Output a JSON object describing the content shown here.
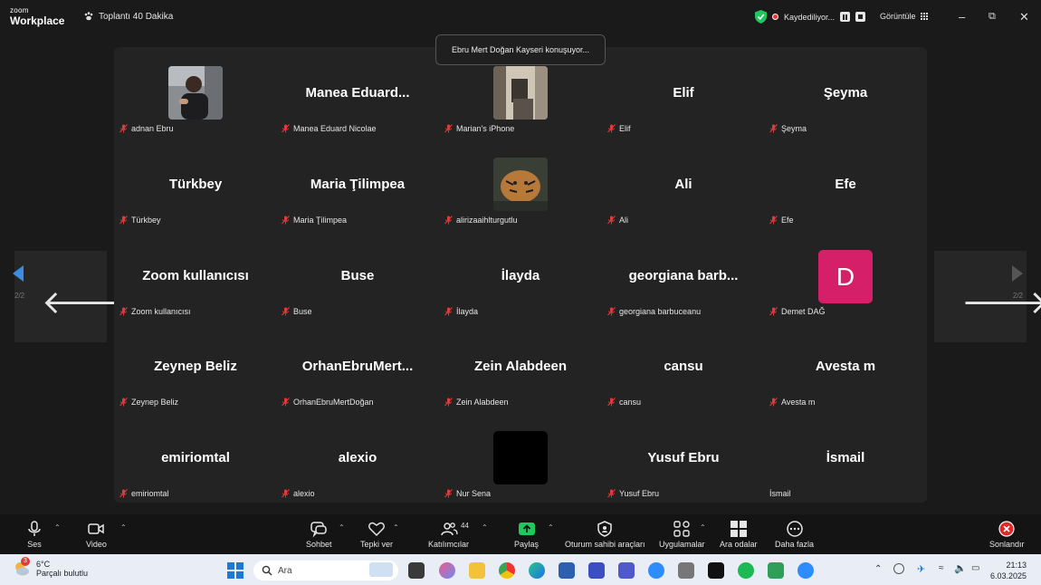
{
  "app": {
    "brand_top": "zoom",
    "brand_bottom": "Workplace",
    "meeting_title": "Toplantı 40 Dakika"
  },
  "recording": {
    "status": "Kaydediliyor..."
  },
  "view": {
    "label": "Görüntüle"
  },
  "speaker_banner": "Ebru Mert Doğan Kayseri konuşuyor...",
  "pagination": {
    "left_page": "2/2",
    "right_page": "2/2"
  },
  "tiles": [
    {
      "title": "",
      "label": "adnan Ebru"
    },
    {
      "title": "Manea Eduard...",
      "label": "Manea Eduard Nicolae"
    },
    {
      "title": "",
      "label": "Marian's iPhone"
    },
    {
      "title": "Elif",
      "label": "Elif"
    },
    {
      "title": "Şeyma",
      "label": "Şeyma"
    },
    {
      "title": "Türkbey",
      "label": "Türkbey"
    },
    {
      "title": "Maria Ţilimpea",
      "label": "Maria Ţilimpea"
    },
    {
      "title": "",
      "label": "alirizaaihlturgutlu"
    },
    {
      "title": "Ali",
      "label": "Ali"
    },
    {
      "title": "Efe",
      "label": "Efe"
    },
    {
      "title": "Zoom kullanıcısı",
      "label": "Zoom kullanıcısı"
    },
    {
      "title": "Buse",
      "label": "Buse"
    },
    {
      "title": "İlayda",
      "label": "İlayda"
    },
    {
      "title": "georgiana barb...",
      "label": "georgiana barbuceanu"
    },
    {
      "title": "D",
      "label": "Demet DAĞ"
    },
    {
      "title": "Zeynep Beliz",
      "label": "Zeynep Beliz"
    },
    {
      "title": "OrhanEbruMert...",
      "label": "OrhanEbruMertDoğan"
    },
    {
      "title": "Zein Alabdeen",
      "label": "Zein Alabdeen"
    },
    {
      "title": "cansu",
      "label": "cansu"
    },
    {
      "title": "Avesta m",
      "label": "Avesta m"
    },
    {
      "title": "emiriomtal",
      "label": "emiriomtal"
    },
    {
      "title": "alexio",
      "label": "alexio"
    },
    {
      "title": "",
      "label": "Nur Sena"
    },
    {
      "title": "Yusuf Ebru",
      "label": "Yusuf Ebru"
    },
    {
      "title": "İsmail",
      "label": "İsmail"
    }
  ],
  "toolbar": {
    "audio": "Ses",
    "video": "Video",
    "chat": "Sohbet",
    "react": "Tepki ver",
    "participants": "Katılımcılar",
    "participants_count": "44",
    "share": "Paylaş",
    "host_tools": "Oturum sahibi araçları",
    "apps": "Uygulamalar",
    "breakout": "Ara odalar",
    "more": "Daha fazla",
    "end": "Sonlandır"
  },
  "taskbar": {
    "weather_temp": "6°C",
    "weather_desc": "Parçalı bulutlu",
    "weather_badge": "3",
    "search_placeholder": "Ara",
    "time": "21:13",
    "date": "6.03.2025"
  },
  "colors": {
    "avatar_d": "#d61f69",
    "share_green": "#22c55e",
    "end_red": "#e02828",
    "rec_red": "#e33333"
  }
}
